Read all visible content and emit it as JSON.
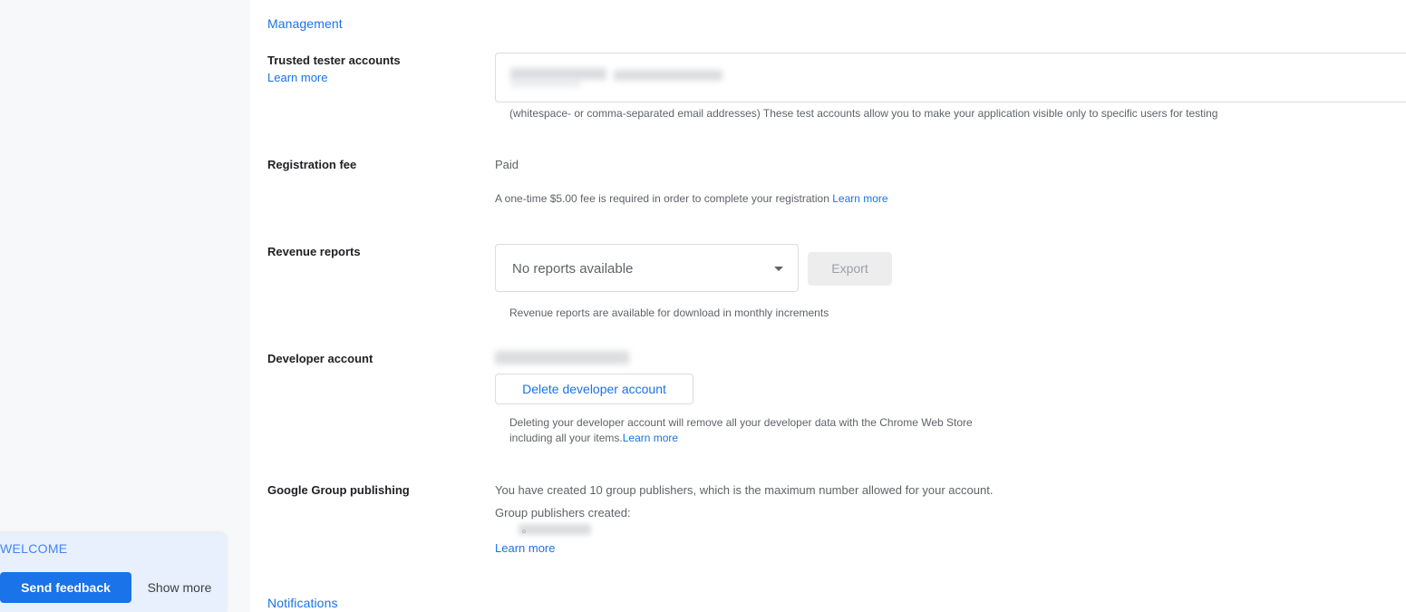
{
  "sections": {
    "management": "Management",
    "notifications": "Notifications"
  },
  "trusted_testers": {
    "label": "Trusted tester accounts",
    "learn_more": "Learn more",
    "input_value": "",
    "input_placeholder": "",
    "helper": "(whitespace- or comma-separated email addresses) These test accounts allow you to make your application visible only to specific users for testing"
  },
  "registration_fee": {
    "label": "Registration fee",
    "status": "Paid",
    "helper": "A one-time $5.00 fee is required in order to complete your registration",
    "learn_more": "Learn more"
  },
  "revenue_reports": {
    "label": "Revenue reports",
    "selected_option": "No reports available",
    "options": [
      "No reports available"
    ],
    "export_label": "Export",
    "helper": "Revenue reports are available for download in monthly increments"
  },
  "developer_account": {
    "label": "Developer account",
    "account_email": "",
    "delete_label": "Delete developer account",
    "helper": "Deleting your developer account will remove all your developer data with the Chrome Web Store including all your items.",
    "learn_more": "Learn more"
  },
  "google_group_publishing": {
    "label": "Google Group publishing",
    "summary": "You have created 10 group publishers, which is the maximum number allowed for your account.",
    "created_label": "Group publishers created:",
    "publishers": [
      ""
    ],
    "learn_more": "Learn more"
  },
  "feedback_widget": {
    "title": "WELCOME",
    "send_feedback_label": "Send feedback",
    "show_more_label": "Show more"
  },
  "colors": {
    "accent_blue": "#1a73e8",
    "link_blue": "#4285f4",
    "text_primary": "#202124",
    "text_secondary": "#5f6368",
    "rail_bg": "#f6f8f9",
    "feedback_bg": "#e8f0fe",
    "disabled_bg": "#ededee",
    "border": "#dadce0"
  }
}
